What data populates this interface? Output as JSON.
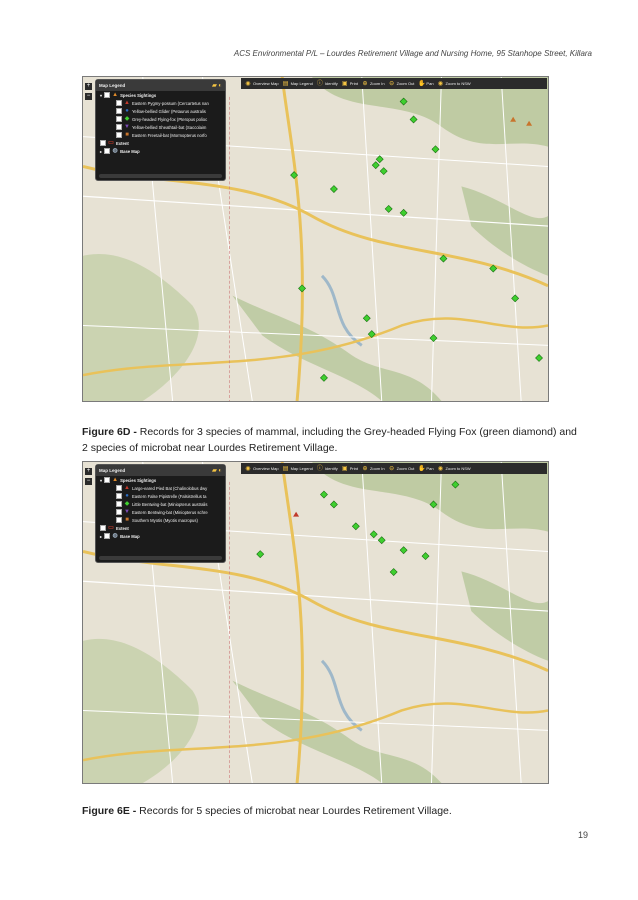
{
  "header": "ACS Environmental P/L – Lourdes Retirement Village and Nursing Home, 95 Stanhope Street, Killara",
  "page_number": "19",
  "toolbar": {
    "items": [
      {
        "label": "Overview Map",
        "icon": "globe-icon"
      },
      {
        "label": "Map Legend",
        "icon": "legend-icon"
      },
      {
        "label": "Identify",
        "icon": "info-icon"
      },
      {
        "label": "Print",
        "icon": "print-icon"
      },
      {
        "label": "Zoom In",
        "icon": "zoom-in-icon"
      },
      {
        "label": "Zoom Out",
        "icon": "zoom-out-icon"
      },
      {
        "label": "Pan",
        "icon": "hand-icon"
      },
      {
        "label": "Zoom to NSW",
        "icon": "globe-icon"
      }
    ]
  },
  "figure_6d": {
    "legend": {
      "title": "Map Legend",
      "group": "Species Sightings",
      "species": [
        {
          "label": "Eastern Pygmy-possum (Cercartetus nan",
          "symbol": "triangle",
          "color": "#c0392b"
        },
        {
          "label": "Yellow-bellied Glider (Petaurus australis",
          "symbol": "circle",
          "color": "#2d6cc0"
        },
        {
          "label": "Grey-headed Flying-fox (Pteropus polioc",
          "symbol": "diamond",
          "color": "#3fcf2f"
        },
        {
          "label": "Yellow-bellied Sheathtail-bat (Saccolaim",
          "symbol": "triangle-down",
          "color": "#7b4bb5"
        },
        {
          "label": "Eastern Freetail-bat (Mormopterus norfo",
          "symbol": "square",
          "color": "#c8742c"
        }
      ],
      "extent": "Extent",
      "base_map": "Base Map"
    },
    "caption_bold": "Figure 6D -",
    "caption_text": " Records for 3 species of mammal, including the Grey-headed Flying Fox (green diamond) and 2 species of microbat near Lourdes Retirement Village."
  },
  "figure_6e": {
    "legend": {
      "title": "Map Legend",
      "group": "Species Sightings",
      "species": [
        {
          "label": "Large-eared Pied Bat (Chalinolobus dwy",
          "symbol": "triangle",
          "color": "#c0392b"
        },
        {
          "label": "Eastern False Pipistrelle (Falsistrellus ta",
          "symbol": "circle",
          "color": "#2d6cc0"
        },
        {
          "label": "Little Bentwing-bat (Miniopterus australis",
          "symbol": "diamond",
          "color": "#3fcf2f"
        },
        {
          "label": "Eastern Bentwing-bat (Miniopterus schre",
          "symbol": "triangle-down",
          "color": "#7b4bb5"
        },
        {
          "label": "Southern Myotis (Myotis macropus)",
          "symbol": "square",
          "color": "#c8742c"
        }
      ],
      "extent": "Extent",
      "base_map": "Base Map"
    },
    "caption_bold": "Figure 6E -",
    "caption_text": " Records for 5 species of microbat near Lourdes Retirement Village."
  },
  "colors": {
    "map_base": "#e7e2d4",
    "major_road": "#e9c25a",
    "minor_road": "#ffffff",
    "bushland": "#b7c79a",
    "marker_green": "#3fcf2f",
    "toolbar_bg": "#2b2b2b"
  }
}
